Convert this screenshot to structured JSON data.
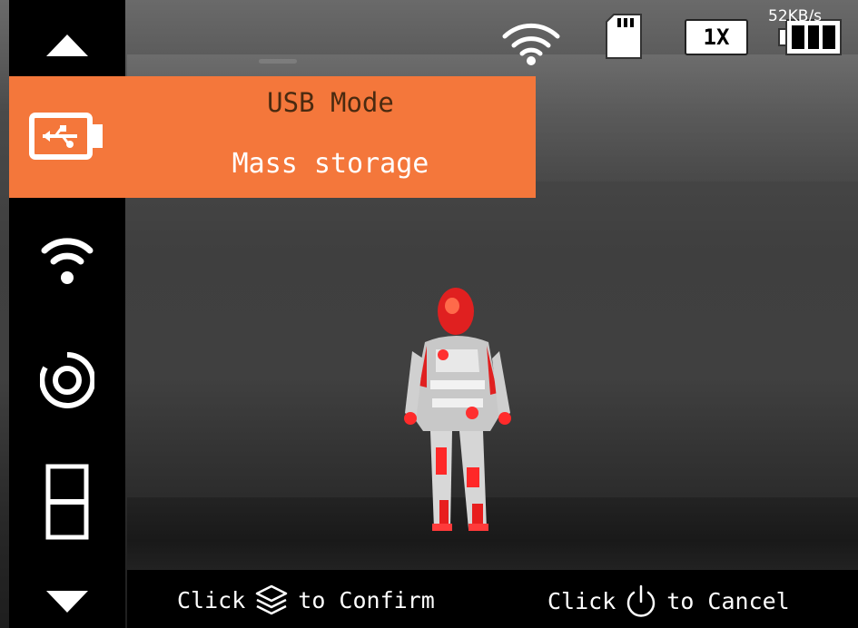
{
  "status_bar": {
    "icons": [
      "wifi-icon",
      "sd-card-icon",
      "battery-icon"
    ],
    "zoom": "1X",
    "transfer_speed": "52KB/s",
    "battery_level": 1.0
  },
  "sidebar": {
    "items": [
      {
        "icon": "arrow-up-icon"
      },
      {
        "icon": "usb-icon",
        "selected": true
      },
      {
        "icon": "wifi-icon"
      },
      {
        "icon": "target-icon"
      },
      {
        "icon": "display-mode-icon"
      },
      {
        "icon": "arrow-down-icon"
      }
    ]
  },
  "popup": {
    "title": "USB Mode",
    "value": "Mass storage",
    "color": "#f4773b"
  },
  "hints": {
    "confirm_prefix": "Click",
    "confirm_suffix": "to Confirm",
    "confirm_icon": "layers-icon",
    "cancel_prefix": "Click",
    "cancel_suffix": "to Cancel",
    "cancel_icon": "power-icon"
  }
}
